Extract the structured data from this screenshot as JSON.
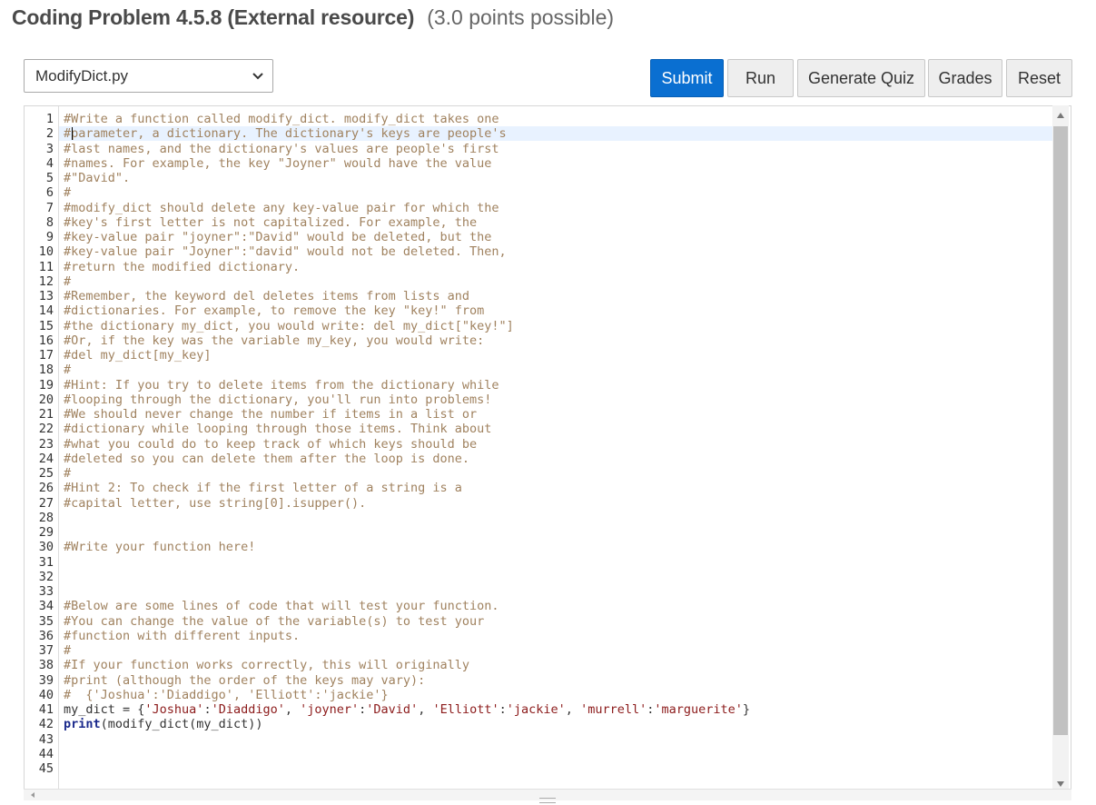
{
  "header": {
    "title": "Coding Problem 4.5.8 (External resource)",
    "points": "(3.0 points possible)"
  },
  "toolbar": {
    "file_select": "ModifyDict.py",
    "submit": "Submit",
    "run": "Run",
    "generate_quiz": "Generate Quiz",
    "grades": "Grades",
    "reset": "Reset"
  },
  "editor": {
    "active_line": 2,
    "lines": [
      "#Write a function called modify_dict. modify_dict takes one",
      "#parameter, a dictionary. The dictionary's keys are people's",
      "#last names, and the dictionary's values are people's first",
      "#names. For example, the key \"Joyner\" would have the value",
      "#\"David\".",
      "#",
      "#modify_dict should delete any key-value pair for which the",
      "#key's first letter is not capitalized. For example, the",
      "#key-value pair \"joyner\":\"David\" would be deleted, but the",
      "#key-value pair \"Joyner\":\"david\" would not be deleted. Then,",
      "#return the modified dictionary.",
      "#",
      "#Remember, the keyword del deletes items from lists and",
      "#dictionaries. For example, to remove the key \"key!\" from",
      "#the dictionary my_dict, you would write: del my_dict[\"key!\"]",
      "#Or, if the key was the variable my_key, you would write:",
      "#del my_dict[my_key]",
      "#",
      "#Hint: If you try to delete items from the dictionary while",
      "#looping through the dictionary, you'll run into problems!",
      "#We should never change the number if items in a list or",
      "#dictionary while looping through those items. Think about",
      "#what you could do to keep track of which keys should be",
      "#deleted so you can delete them after the loop is done.",
      "#",
      "#Hint 2: To check if the first letter of a string is a",
      "#capital letter, use string[0].isupper().",
      "",
      "",
      "#Write your function here!",
      "",
      "",
      "",
      "#Below are some lines of code that will test your function.",
      "#You can change the value of the variable(s) to test your",
      "#function with different inputs.",
      "#",
      "#If your function works correctly, this will originally",
      "#print (although the order of the keys may vary):",
      "#  {'Joshua':'Diaddigo', 'Elliott':'jackie'}",
      "my_dict = {'Joshua':'Diaddigo', 'joyner':'David', 'Elliott':'jackie', 'murrell':'marguerite'}",
      "print(modify_dict(my_dict))",
      "",
      "",
      ""
    ]
  }
}
